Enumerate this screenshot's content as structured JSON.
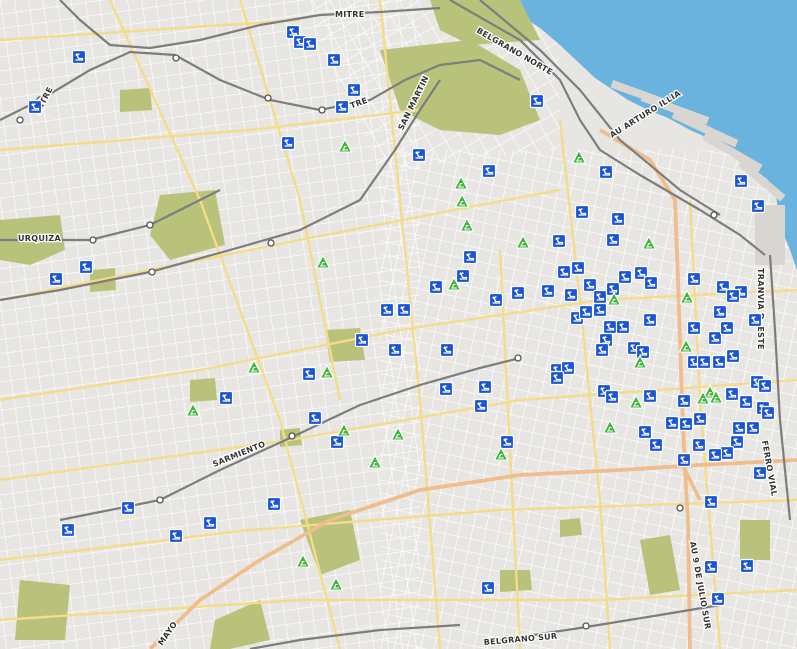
{
  "map": {
    "colors": {
      "land": "#e8e6e3",
      "water": "#6bb3df",
      "park": "#b9c27a",
      "street": "#ffffff",
      "avenue": "#f3dc8a",
      "highway": "#efbd8e",
      "rail": "#7d7d7d",
      "station": "#ffffff",
      "marker_blue": "#1a55d6",
      "marker_green": "#3fb53a"
    },
    "labels": {
      "mitre_top": "MITRE",
      "mitre_left": "MITRE",
      "tre": "TRE",
      "belgrano_norte": "BELGRANO NORTE",
      "san_martin": "SAN MARTIN",
      "au_arturo_illia": "AU ARTURO ILLIA",
      "urquiza": "URQUIZA",
      "tranvia_del_este": "TRANVIA D. ESTE",
      "sarmiento": "SARMIENTO",
      "ferrovial": "FERRO VIAL",
      "au_9_de_julio_sur": "AU 9 DE JULIO SUR",
      "belgrano_sur": "BELGRANO SUR",
      "mayo": "MAYO"
    },
    "marker_icons": {
      "blue": "blue-square-marker-icon",
      "green": "green-triangle-marker-icon"
    }
  }
}
